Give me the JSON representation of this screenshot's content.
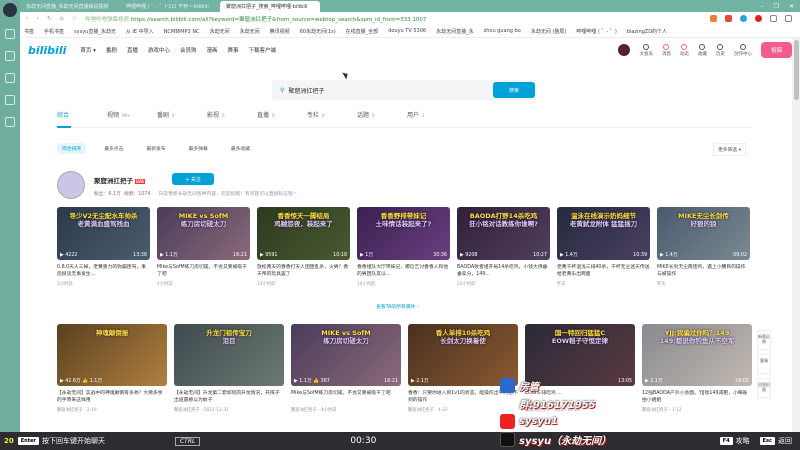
{
  "browser": {
    "tabs": [
      {
        "label": "永劫无间直播_永劫无间直播解说视频"
      },
      {
        "label": "哔哩哔哩 ( ゜- ゜)つロ 干杯~-bilibili"
      },
      {
        "label": "聚窟洲扛把子_搜索_哔哩哔哩-bilibili"
      }
    ],
    "url_site": "哔哩哔哩弹幕视频",
    "url": "https://search.bilibili.com/all?keyword=聚窟洲扛把子&from_source=webtop_search&spm_id_from=333.1007",
    "bookmarks": [
      "书签",
      "手机书签",
      "sysyu直播_永劫无",
      "从 IE 中导入",
      "NCM转MP3 NC",
      "永劫无间",
      "永劫无间",
      "腾讯视频",
      "60永劫无间(1s)",
      "在线直播_全部",
      "douyu TV 5306",
      "永劫无间直播_永",
      "zhou guang bo",
      "永劫无间 (整局)",
      "哔哩哔哩 ( ゜- ゜)",
      "blazingZD的个人"
    ]
  },
  "header": {
    "logo": "bilibili",
    "nav": [
      "首页 ▾",
      "番剧",
      "直播",
      "游戏中心",
      "会员购",
      "漫画",
      "赛事",
      "下载客户端"
    ],
    "icons": [
      {
        "label": "大会员"
      },
      {
        "label": "消息",
        "badge": "5"
      },
      {
        "label": "动态",
        "badge": "7"
      },
      {
        "label": "收藏"
      },
      {
        "label": "历史"
      },
      {
        "label": "创作中心"
      }
    ],
    "upload": "投稿"
  },
  "search": {
    "value": "聚窟洲扛把子",
    "button": "搜索"
  },
  "tabs": [
    {
      "label": "综合",
      "count": ""
    },
    {
      "label": "视频",
      "count": "99+"
    },
    {
      "label": "番剧",
      "count": "0"
    },
    {
      "label": "影视",
      "count": "0"
    },
    {
      "label": "直播",
      "count": "0"
    },
    {
      "label": "专栏",
      "count": "0"
    },
    {
      "label": "话题",
      "count": "0"
    },
    {
      "label": "用户",
      "count": "1"
    }
  ],
  "sorts": [
    "综合排序",
    "最多点击",
    "最新发布",
    "最多弹幕",
    "最多收藏"
  ],
  "more_filter": "更多筛选 ▾",
  "user": {
    "name": "聚窟洲扛把子",
    "level": "LV6",
    "follow": "+ 关注",
    "fans": "粉丝：6.1万",
    "videos": "视频：1074",
    "desc": "日常更新永劫无间各种内容，欢迎投稿！有问题可以直接私信我~"
  },
  "row1": [
    {
      "thumb": "导少V2无尘配水车帅杀\n老黄满血盛驾残血",
      "plays": "4222",
      "duration": "13:36",
      "title": "0.8.0天人三掉，老黄重力的驹蹦连驾，事后很谈无事发生...",
      "time": "1小时前",
      "c1": "#2b3a4a",
      "c2": "#4a5d70"
    },
    {
      "thumb": "MIKE vs SofM\n练刀房切磋太刀",
      "plays": "1.1万",
      "duration": "16:21",
      "title": "Mike与SofM练刀房切磋，不会又要被吸干了吧",
      "time": "4小时前",
      "c1": "#4a3c5a",
      "c2": "#8b6a7a"
    },
    {
      "thumb": "香香惊天一脚结局\n鸡贼怨夜，装起来了",
      "plays": "9591",
      "duration": "10:18",
      "title": "放松两天的香香打天人困困乱杀，火男？香天帝的玩具罢了",
      "time": "13小时前",
      "c1": "#2c3a20",
      "c2": "#4a5a30"
    },
    {
      "thumb": "香香野排带妹记\n土味情话装起来了?",
      "plays": "1万",
      "duration": "30:36",
      "title": "香香组队大厅带妹记，嘟信乞讨香香人和他的男团队友以...",
      "time": "14小时前",
      "c1": "#3a2050",
      "c2": "#6a4080"
    },
    {
      "thumb": "BAODA打野14杀吃鸡\n狂小铭对话教练你谁啊?",
      "plays": "9208",
      "duration": "10:27",
      "title": "BAODA败者组开局14杀吃鸡，小钱大佛垂垂拿分，149...",
      "time": "22小时前",
      "c1": "#302038",
      "c2": "#504060"
    },
    {
      "thumb": "温泳在线演示奶妈细节\n老黄弑龙附体 猛猛插刀",
      "plays": "1.4万",
      "duration": "10:39",
      "title": "老黄干杯温浅三排40杀，干杯无尘迷天传送给老黄乐出两面",
      "time": "昨天",
      "c1": "#262a40",
      "c2": "#4a4060"
    },
    {
      "thumb": "MIKE无尘长剑传\n好狠的狼",
      "plays": "1.4万",
      "duration": "09:02",
      "title": "MIKE长剑无尘两连鸡，遇上小腰目的操作与被操作",
      "time": "昨天",
      "c1": "#4a5a70",
      "c2": "#7a8a90"
    }
  ],
  "view_all": "查看TA的所有稿件 ›",
  "row2": [
    {
      "thumb": "神魂颠倒振",
      "plays": "42.6万",
      "likes": "1.1万",
      "title": "【永劫无间】实战中的神魂颠倒有多帅？大佛多余的手原来这样用",
      "meta": "聚窟洲扛把子 · 2-19",
      "c1": "#5a4020",
      "c2": "#b08040"
    },
    {
      "thumb": "升龙门祖传宝刀\n泪目",
      "plays": "",
      "likes": "",
      "title": "【永劫无间】升龙第二套如何的升龙情况，开挥子出道震撼以为蚊子",
      "meta": "聚窟洲扛把子 · 2021-12-31",
      "c1": "#404a50",
      "c2": "#6a7a70"
    },
    {
      "thumb": "MIKE vs SofM\n练刀房切磋太刀",
      "plays": "1.1万",
      "likes": "367",
      "duration": "16:21",
      "title": "Mike与SofM练刀房切磋，不会又要被吸干了吧",
      "meta": "聚窟洲扛把子 · 4小时前",
      "c1": "#4a3c5a",
      "c2": "#8b6a7a"
    },
    {
      "thumb": "香人单排10杀吃鸡\n长剑太刀换着使",
      "plays": "2.1万",
      "likes": "",
      "title": "香香：只要你进入到1v1的状态，能操作出平时想不到的操作",
      "meta": "聚窟洲扛把子 · 4-22",
      "c1": "#4a3020",
      "c2": "#8a5a30"
    },
    {
      "thumb": "国一特回归猛猛C\nEOW稻子守恒定律",
      "plays": "",
      "likes": "",
      "duration": "13:05",
      "title": "EOW三排吃鸡 ...",
      "meta": "聚窟洲扛把子 · 2021-12-28",
      "c1": "#2a2a38",
      "c2": "#5a3a40"
    },
    {
      "thumb": "YJJ:我骗过你吗？149\n149:都说你钓鱼从不空军",
      "plays": "2.1万",
      "likes": "",
      "duration": "29:05",
      "title": "12强BAODA户外小会面，YJJ劝149减肥，小细雀拍小姐姐",
      "meta": "聚窟洲扛把子 · 1-12",
      "c1": "#8a8a90",
      "c2": "#c0b8b0"
    }
  ],
  "float_buttons": [
    "新版反馈",
    "客服",
    "回到旧版"
  ],
  "stream_overlay": {
    "enter_key": "Enter",
    "chat_hint": "按下回车键开始聊天",
    "ctrl": "CTRL",
    "timer": "00:30",
    "lines": [
      "房管",
      "群:916171955",
      "sysyu1",
      "sysyu（永劫无间）"
    ],
    "f4": "F4",
    "f4_label": "攻略",
    "esc": "Esc",
    "esc_label": "返回",
    "level": "20"
  }
}
